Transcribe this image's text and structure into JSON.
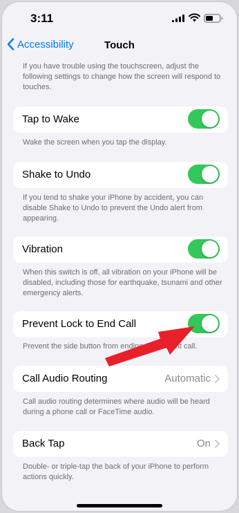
{
  "status": {
    "time": "3:11"
  },
  "nav": {
    "back_label": "Accessibility",
    "title": "Touch"
  },
  "intro": "If you have trouble using the touchscreen, adjust the following settings to change how the screen will respond to touches.",
  "settings": [
    {
      "label": "Tap to Wake",
      "type": "toggle",
      "on": true,
      "footer": "Wake the screen when you tap the display."
    },
    {
      "label": "Shake to Undo",
      "type": "toggle",
      "on": true,
      "footer": "If you tend to shake your iPhone by accident, you can disable Shake to Undo to prevent the Undo alert from appearing."
    },
    {
      "label": "Vibration",
      "type": "toggle",
      "on": true,
      "footer": "When this switch is off, all vibration on your iPhone will be disabled, including those for earthquake, tsunami and other emergency alerts."
    },
    {
      "label": "Prevent Lock to End Call",
      "type": "toggle",
      "on": true,
      "footer": "Prevent the side button from ending the current call."
    },
    {
      "label": "Call Audio Routing",
      "type": "detail",
      "value": "Automatic",
      "footer": "Call audio routing determines where audio will be heard during a phone call or FaceTime audio."
    },
    {
      "label": "Back Tap",
      "type": "detail",
      "value": "On",
      "footer": "Double- or triple-tap the back of your iPhone to perform actions quickly."
    }
  ],
  "colors": {
    "accent": "#007aff",
    "toggle_on": "#34c759",
    "annotation_arrow": "#e8202a"
  }
}
